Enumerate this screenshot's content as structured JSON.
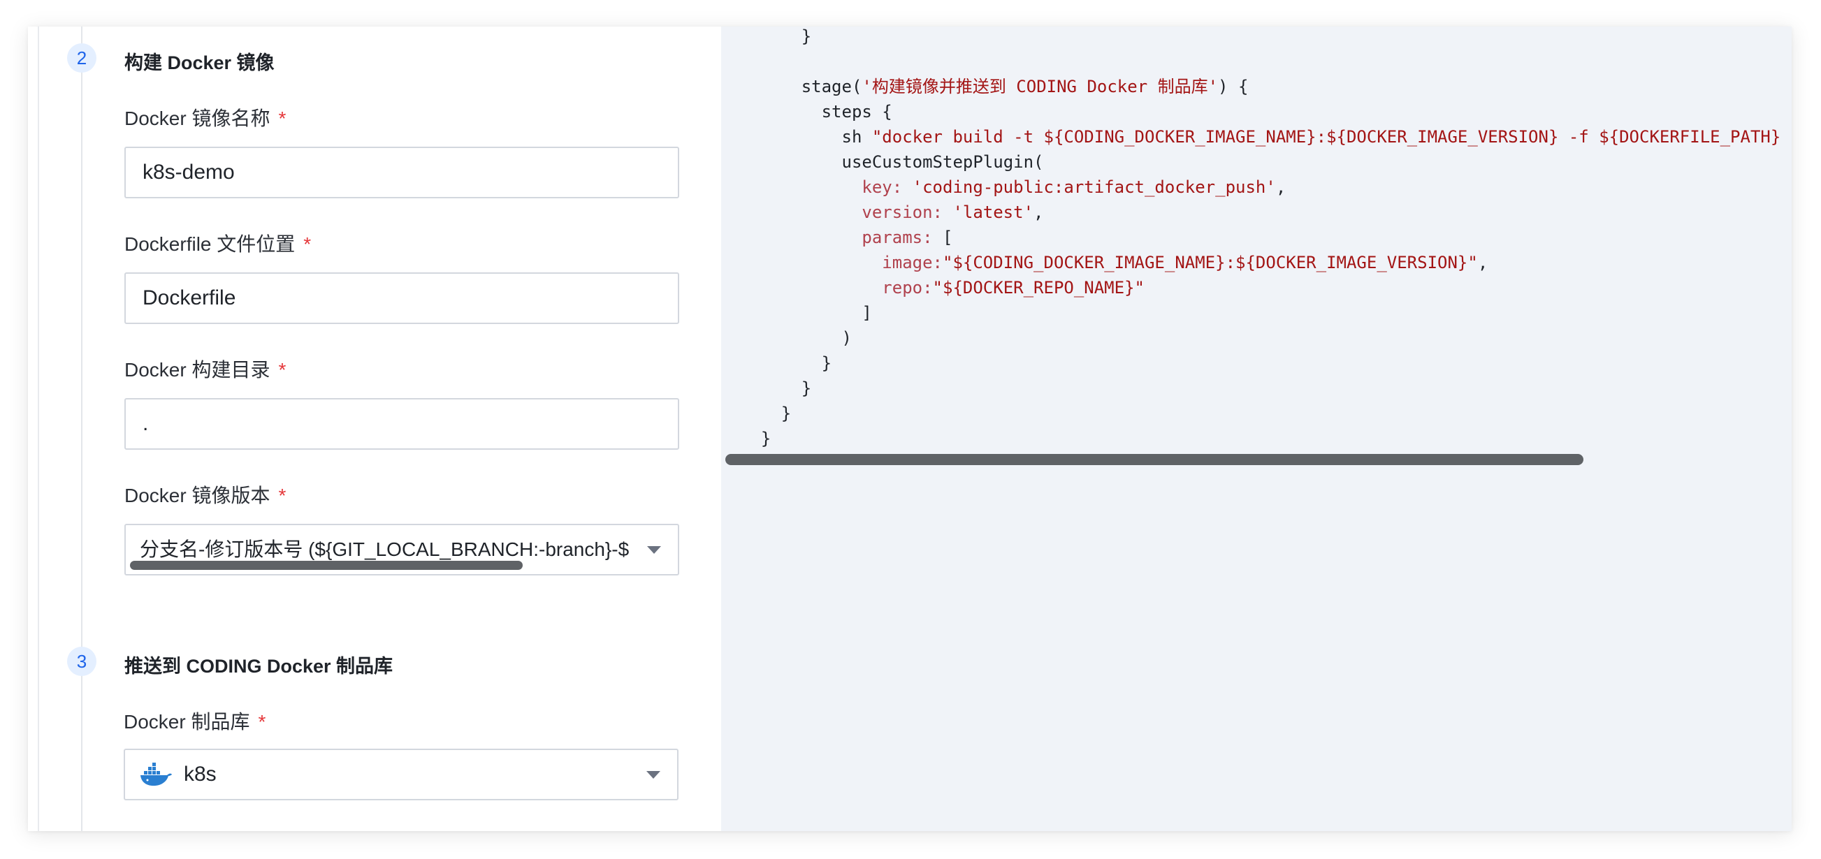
{
  "steps": [
    {
      "number": "2",
      "title": "构建 Docker 镜像"
    },
    {
      "number": "3",
      "title": "推送到 CODING Docker 制品库"
    }
  ],
  "fields": {
    "image_name": {
      "label": "Docker 镜像名称",
      "required": "*",
      "value": "k8s-demo"
    },
    "dockerfile": {
      "label": "Dockerfile 文件位置",
      "required": "*",
      "value": "Dockerfile"
    },
    "build_dir": {
      "label": "Docker 构建目录",
      "required": "*",
      "value": "."
    },
    "image_version": {
      "label": "Docker 镜像版本",
      "required": "*",
      "value": "分支名-修订版本号 (${GIT_LOCAL_BRANCH:-branch}-$"
    },
    "repo": {
      "label": "Docker 制品库",
      "required": "*",
      "value": "k8s",
      "icon": "docker-whale-icon"
    }
  },
  "code": {
    "lines": [
      {
        "indent": "      ",
        "parts": [
          {
            "t": "}",
            "c": ""
          }
        ]
      },
      {
        "indent": "",
        "parts": []
      },
      {
        "indent": "      ",
        "parts": [
          {
            "t": "stage(",
            "c": ""
          },
          {
            "t": "'构建镜像并推送到 CODING Docker 制品库'",
            "c": "s"
          },
          {
            "t": ") {",
            "c": ""
          }
        ]
      },
      {
        "indent": "        ",
        "parts": [
          {
            "t": "steps {",
            "c": ""
          }
        ]
      },
      {
        "indent": "          ",
        "parts": [
          {
            "t": "sh ",
            "c": ""
          },
          {
            "t": "\"docker build -t ${CODING_DOCKER_IMAGE_NAME}:${DOCKER_IMAGE_VERSION} -f ${DOCKERFILE_PATH} ${DOCKER_BUILD_CONTEXT}\"",
            "c": "s"
          }
        ]
      },
      {
        "indent": "          ",
        "parts": [
          {
            "t": "useCustomStepPlugin(",
            "c": ""
          }
        ]
      },
      {
        "indent": "            ",
        "parts": [
          {
            "t": "key: ",
            "c": "k"
          },
          {
            "t": "'coding-public:artifact_docker_push'",
            "c": "s"
          },
          {
            "t": ",",
            "c": ""
          }
        ]
      },
      {
        "indent": "            ",
        "parts": [
          {
            "t": "version: ",
            "c": "k"
          },
          {
            "t": "'latest'",
            "c": "s"
          },
          {
            "t": ",",
            "c": ""
          }
        ]
      },
      {
        "indent": "            ",
        "parts": [
          {
            "t": "params: ",
            "c": "k"
          },
          {
            "t": "[",
            "c": ""
          }
        ]
      },
      {
        "indent": "              ",
        "parts": [
          {
            "t": "image:",
            "c": "k"
          },
          {
            "t": "\"${CODING_DOCKER_IMAGE_NAME}:${DOCKER_IMAGE_VERSION}\"",
            "c": "s"
          },
          {
            "t": ",",
            "c": ""
          }
        ]
      },
      {
        "indent": "              ",
        "parts": [
          {
            "t": "repo:",
            "c": "k"
          },
          {
            "t": "\"${DOCKER_REPO_NAME}\"",
            "c": "s"
          }
        ]
      },
      {
        "indent": "            ",
        "parts": [
          {
            "t": "]",
            "c": ""
          }
        ]
      },
      {
        "indent": "          ",
        "parts": [
          {
            "t": ")",
            "c": ""
          }
        ]
      },
      {
        "indent": "        ",
        "parts": [
          {
            "t": "}",
            "c": ""
          }
        ]
      },
      {
        "indent": "      ",
        "parts": [
          {
            "t": "}",
            "c": ""
          }
        ]
      },
      {
        "indent": "    ",
        "parts": [
          {
            "t": "}",
            "c": ""
          }
        ]
      },
      {
        "indent": "  ",
        "parts": [
          {
            "t": "}",
            "c": ""
          }
        ]
      }
    ]
  },
  "colors": {
    "accent": "#1e64ea",
    "required": "#e5383b",
    "code_string": "#a31515",
    "code_key": "#b0414d",
    "code_bg": "#f0f3f8"
  }
}
